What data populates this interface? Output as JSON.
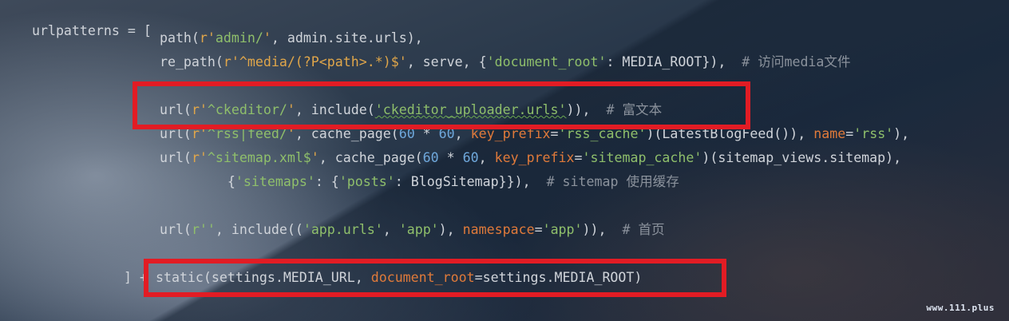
{
  "code": {
    "l1": {
      "a": "urlpatterns = ["
    },
    "l2": {
      "a": "    path(",
      "b": "r'",
      "c": "admin/",
      "d": "'",
      "e": ", admin.site.urls),"
    },
    "l3": {
      "a": "    re_path(",
      "b": "r'",
      "c": "^media/(?P<path>.*)$",
      "d": "'",
      "e": ", serve, {",
      "f": "'document_root'",
      "g": ": MEDIA_ROOT}),  ",
      "h": "# 访问media文件"
    },
    "l4": {
      "a": "    url(",
      "b": "r'",
      "c": "^ckeditor/",
      "d": "'",
      "e": ", include(",
      "f": "'ckeditor_uploader.urls'",
      "g": ")),  ",
      "h": "# 富文本"
    },
    "l5": {
      "a": "    url(",
      "b": "r'",
      "c": "^rss|feed/",
      "d": "'",
      "e": ", cache_page(",
      "f": "60",
      "g": " * ",
      "h": "60",
      "i": ", ",
      "j": "key_prefix",
      "k": "=",
      "l": "'rss_cache'",
      "m": ")(LatestBlogFeed()), ",
      "n": "name",
      "o": "=",
      "p": "'rss'",
      "q": "),"
    },
    "l6": {
      "a": "    url(",
      "b": "r'",
      "c": "^sitemap.xml$",
      "d": "'",
      "e": ", cache_page(",
      "f": "60",
      "g": " * ",
      "h": "60",
      "i": ", ",
      "j": "key_prefix",
      "k": "=",
      "l": "'sitemap_cache'",
      "m": ")(sitemap_views.sitemap),"
    },
    "l7": {
      "a": "        {",
      "b": "'sitemaps'",
      "c": ": {",
      "d": "'posts'",
      "e": ": BlogSitemap}}),  ",
      "f": "# sitemap 使用缓存"
    },
    "l8": {
      "a": "    url(",
      "b": "r''",
      "c": ", include((",
      "d": "'app.urls'",
      "e": ", ",
      "f": "'app'",
      "g": "), ",
      "h": "namespace",
      "i": "=",
      "j": "'app'",
      "k": ")),  ",
      "l": "# 首页"
    },
    "l9": {
      "a": "] + ",
      "b": "static(settings.MEDIA_URL, ",
      "c": "document_root",
      "d": "=settings.MEDIA_ROOT)"
    }
  },
  "watermark": "www.111.plus",
  "colors": {
    "highlight_box": "#e21c24",
    "string": "#8fbf6b",
    "regex": "#e0a64a",
    "number": "#6fa8dc",
    "keyword_arg": "#e07a3a",
    "comment": "#8b929c",
    "text": "#d0d4da"
  }
}
